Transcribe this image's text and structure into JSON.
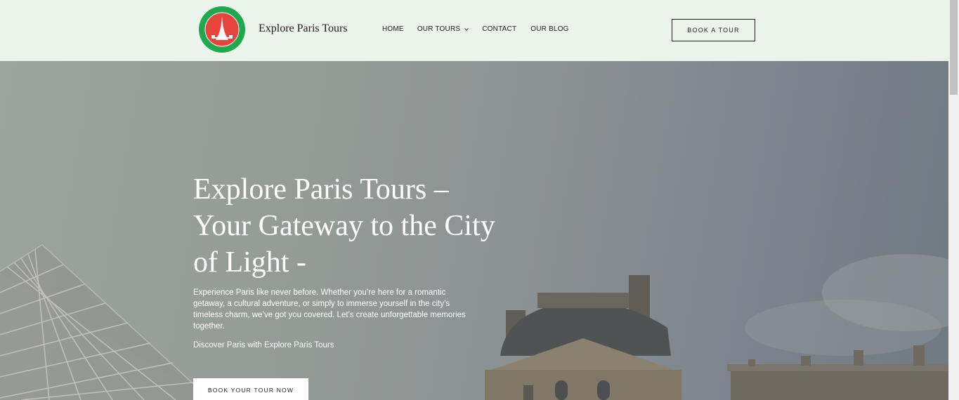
{
  "header": {
    "brand": "Explore Paris Tours",
    "logo_text_top": "EXPLORE PARIS TOURS",
    "nav": [
      {
        "label": "HOME"
      },
      {
        "label": "OUR TOURS",
        "has_dropdown": true
      },
      {
        "label": "CONTACT"
      },
      {
        "label": "OUR BLOG"
      }
    ],
    "cta_label": "BOOK A TOUR"
  },
  "hero": {
    "title": "Explore Paris Tours – Your Gateway to the City of Light -",
    "description": "Experience Paris like never before. Whether you’re here for a romantic getaway, a cultural adventure, or simply to immerse yourself in the city’s timeless charm, we’ve got you covered. Let’s create unforgettable memories together.",
    "subtitle": "Discover Paris with Explore Paris Tours",
    "cta_label": "BOOK YOUR TOUR NOW"
  },
  "colors": {
    "header_bg": "#eaf4ea",
    "logo_ring": "#1fa84f",
    "logo_center": "#e8433d",
    "text_dark": "#1d1d1d",
    "hero_text": "#ffffff"
  },
  "icons": {
    "logo": "eiffel-tower-logo-icon",
    "dropdown": "chevron-down-icon"
  }
}
